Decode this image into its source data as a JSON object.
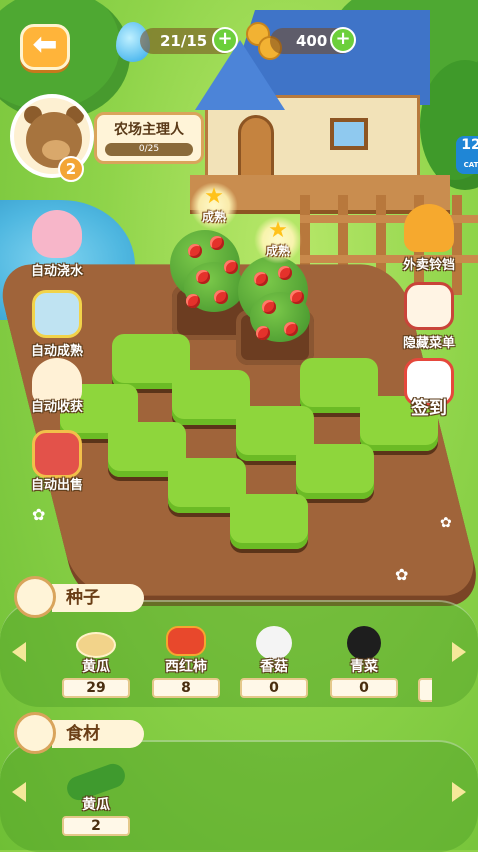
{
  "topbar": {
    "water": "21/15",
    "coins": "400",
    "side_badge": "12",
    "side_badge_sub": "CAT"
  },
  "profile": {
    "title": "农场主理人",
    "level": "2",
    "xp_text": "0/25",
    "xp_progress": 0
  },
  "field": {
    "ripe_label": "成熟",
    "ripe_plots": 2
  },
  "left_actions": [
    {
      "label": "自动浇水",
      "icon": "watering-can-icon"
    },
    {
      "label": "自动成熟",
      "icon": "fertilizer-jar-icon"
    },
    {
      "label": "自动收获",
      "icon": "glove-hand-icon"
    },
    {
      "label": "自动出售",
      "icon": "cart-icon"
    }
  ],
  "right_actions": [
    {
      "label": "外卖铃铛",
      "icon": "service-bell-icon"
    },
    {
      "label": "隐藏菜单",
      "icon": "hidden-menu-icon"
    },
    {
      "label": "签到",
      "icon": "calendar-check-icon"
    }
  ],
  "seeds": {
    "title": "种子",
    "items": [
      {
        "name": "黄瓜",
        "count": "29",
        "color": "#f2d38a"
      },
      {
        "name": "西红柿",
        "count": "8",
        "color": "#e8482c"
      },
      {
        "name": "香菇",
        "count": "0",
        "color": "#f4f4f4"
      },
      {
        "name": "青菜",
        "count": "0",
        "color": "#1e1e1e"
      }
    ]
  },
  "ingredients": {
    "title": "食材",
    "items": [
      {
        "name": "黄瓜",
        "count": "2",
        "color": "#3f9a2e"
      }
    ]
  },
  "colors": {
    "accent": "#ffb43a",
    "grass": "#8ed63c",
    "soil": "#6c3d21",
    "tomato": "#e4322b"
  }
}
